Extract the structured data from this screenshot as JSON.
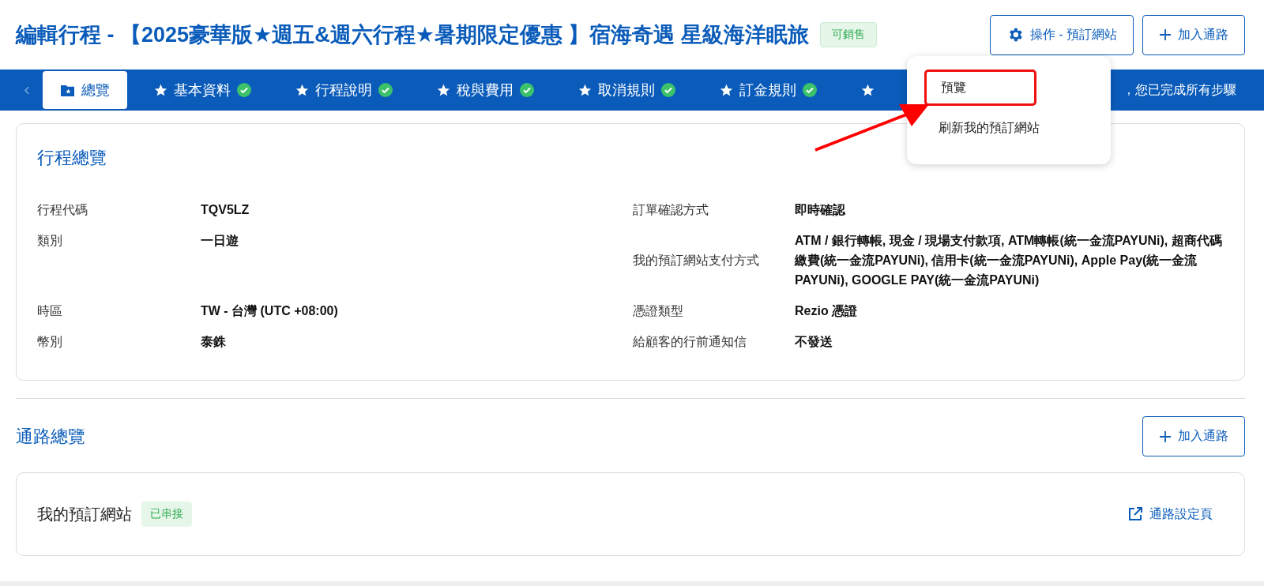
{
  "header": {
    "title": "編輯行程 - 【2025豪華版★週五&週六行程★暑期限定優惠 】宿海奇遇 星級海洋眠旅",
    "status_badge": "可銷售",
    "buttons": [
      {
        "kind": "actions",
        "label": "操作 - 預訂網站"
      },
      {
        "kind": "add",
        "label": "加入通路"
      }
    ]
  },
  "actions_menu": {
    "items": [
      {
        "label": "預覽",
        "highlighted": true
      },
      {
        "label": "刷新我的預訂網站",
        "highlighted": false
      }
    ],
    "annotation_arrow": true
  },
  "steps": {
    "tabs": [
      {
        "label": "總覽",
        "selected": true,
        "completed": false
      },
      {
        "label": "基本資料",
        "selected": false,
        "completed": true
      },
      {
        "label": "行程說明",
        "selected": false,
        "completed": true
      },
      {
        "label": "稅與費用",
        "selected": false,
        "completed": true
      },
      {
        "label": "取消規則",
        "selected": false,
        "completed": true
      },
      {
        "label": "訂金規則",
        "selected": false,
        "completed": true
      },
      {
        "selected": false,
        "completed": false
      }
    ],
    "status_text": "，您已完成所有步驟"
  },
  "overview": {
    "title": "行程總覽",
    "rows": [
      {
        "left": {
          "label": "行程代碼",
          "value": "TQV5LZ"
        },
        "right": {
          "label": "訂單確認方式",
          "value": "即時確認"
        }
      },
      {
        "left": {
          "label": "類別",
          "value": "一日遊"
        },
        "right": {
          "label": "我的預訂網站支付方式",
          "value": "ATM / 銀行轉帳, 現金 / 現場支付款項, ATM轉帳(統一金流PAYUNi), 超商代碼繳費(統一金流PAYUNi), 信用卡(統一金流PAYUNi), Apple Pay(統一金流PAYUNi), GOOGLE PAY(統一金流PAYUNi)"
        }
      },
      {
        "left": {
          "label": "時區",
          "value": "TW - 台灣 (UTC +08:00)"
        },
        "right": {
          "label": "憑證類型",
          "value": "Rezio 憑證"
        }
      },
      {
        "left": {
          "label": "幣別",
          "value": "泰銖"
        },
        "right": {
          "label": "給顧客的行前通知信",
          "value": "不發送"
        }
      }
    ]
  },
  "channels": {
    "title": "通路總覽",
    "add_button": "加入通路",
    "items": [
      {
        "name": "我的預訂網站",
        "status": "已串接",
        "link": "通路設定頁"
      }
    ]
  }
}
